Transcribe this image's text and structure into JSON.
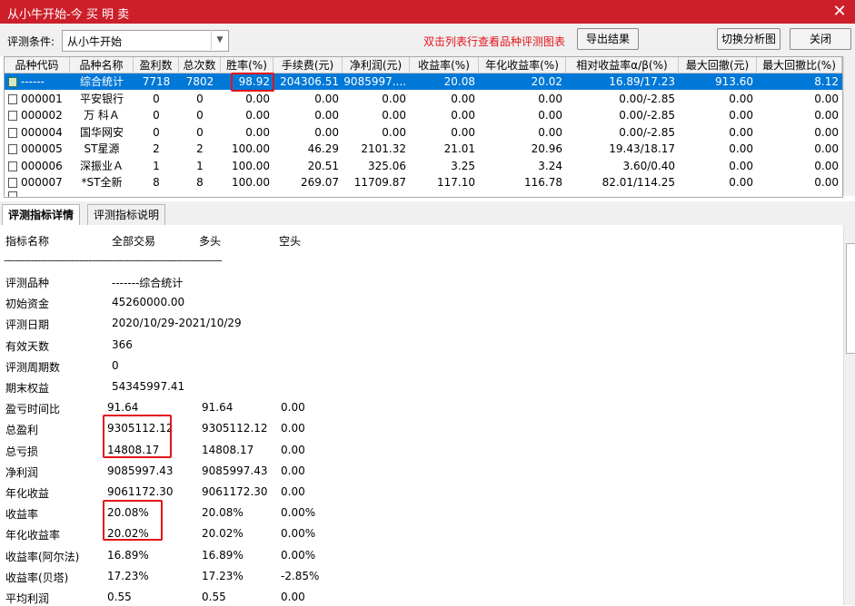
{
  "window": {
    "title": "从小牛开始-今 买 明 卖",
    "close_glyph": "✕"
  },
  "toolbar": {
    "condition_label": "评测条件:",
    "condition_value": "从小牛开始",
    "hint": "双击列表行查看品种评测图表",
    "export_label": "导出结果",
    "switch_label": "切换分析图",
    "close_label": "关闭"
  },
  "table": {
    "headers": [
      "品种代码",
      "品种名称",
      "盈利数",
      "总次数",
      "胜率(%)",
      "手续费(元)",
      "净利润(元)",
      "收益率(%)",
      "年化收益率(%)",
      "相对收益率α/β(%)",
      "最大回撤(元)",
      "最大回撤比(%)"
    ],
    "rows": [
      [
        "------",
        "综合统计",
        "7718",
        "7802",
        "98.92",
        "204306.51",
        "9085997....",
        "20.08",
        "20.02",
        "16.89/17.23",
        "913.60",
        "8.12"
      ],
      [
        "000001",
        "平安银行",
        "0",
        "0",
        "0.00",
        "0.00",
        "0.00",
        "0.00",
        "0.00",
        "0.00/-2.85",
        "0.00",
        "0.00"
      ],
      [
        "000002",
        "万 科Ａ",
        "0",
        "0",
        "0.00",
        "0.00",
        "0.00",
        "0.00",
        "0.00",
        "0.00/-2.85",
        "0.00",
        "0.00"
      ],
      [
        "000004",
        "国华网安",
        "0",
        "0",
        "0.00",
        "0.00",
        "0.00",
        "0.00",
        "0.00",
        "0.00/-2.85",
        "0.00",
        "0.00"
      ],
      [
        "000005",
        "ST星源",
        "2",
        "2",
        "100.00",
        "46.29",
        "2101.32",
        "21.01",
        "20.96",
        "19.43/18.17",
        "0.00",
        "0.00"
      ],
      [
        "000006",
        "深振业Ａ",
        "1",
        "1",
        "100.00",
        "20.51",
        "325.06",
        "3.25",
        "3.24",
        "3.60/0.40",
        "0.00",
        "0.00"
      ],
      [
        "000007",
        "*ST全新",
        "8",
        "8",
        "100.00",
        "269.07",
        "11709.87",
        "117.10",
        "116.78",
        "82.01/114.25",
        "0.00",
        "0.00"
      ]
    ]
  },
  "tabs": [
    "评测指标详情",
    "评测指标说明"
  ],
  "details": {
    "header": [
      "指标名称",
      "全部交易",
      "多头",
      "空头"
    ],
    "divider": "------------------------------------------------------------------------",
    "lines": [
      [
        "评测品种",
        "-------综合统计",
        "",
        ""
      ],
      [
        "初始资金",
        "45260000.00",
        "",
        ""
      ],
      [
        "评测日期",
        "2020/10/29-2021/10/29",
        "",
        ""
      ],
      [
        "有效天数",
        "366",
        "",
        ""
      ],
      [
        "评测周期数",
        "0",
        "",
        ""
      ],
      [
        "期末权益",
        "54345997.41",
        "",
        ""
      ],
      [
        "盈亏时间比",
        "91.64",
        "91.64",
        "0.00"
      ],
      [
        "总盈利",
        "9305112.12",
        "9305112.12",
        "0.00"
      ],
      [
        "总亏损",
        "14808.17",
        "14808.17",
        "0.00"
      ],
      [
        "净利润",
        "9085997.43",
        "9085997.43",
        "0.00"
      ],
      [
        "年化收益",
        "9061172.30",
        "9061172.30",
        "0.00"
      ],
      [
        "收益率",
        "20.08%",
        "20.08%",
        "0.00%"
      ],
      [
        "年化收益率",
        "20.02%",
        "20.02%",
        "0.00%"
      ],
      [
        "收益率(阿尔法)",
        "16.89%",
        "16.89%",
        "0.00%"
      ],
      [
        "收益率(贝塔)",
        "17.23%",
        "17.23%",
        "-2.85%"
      ],
      [
        "平均利润",
        "0.55",
        "0.55",
        "0.00"
      ]
    ]
  },
  "colors": {
    "titlebar": "#cc1f2a",
    "selection": "#0078d7",
    "highlight": "#e3131b",
    "hint": "#e3131b"
  }
}
